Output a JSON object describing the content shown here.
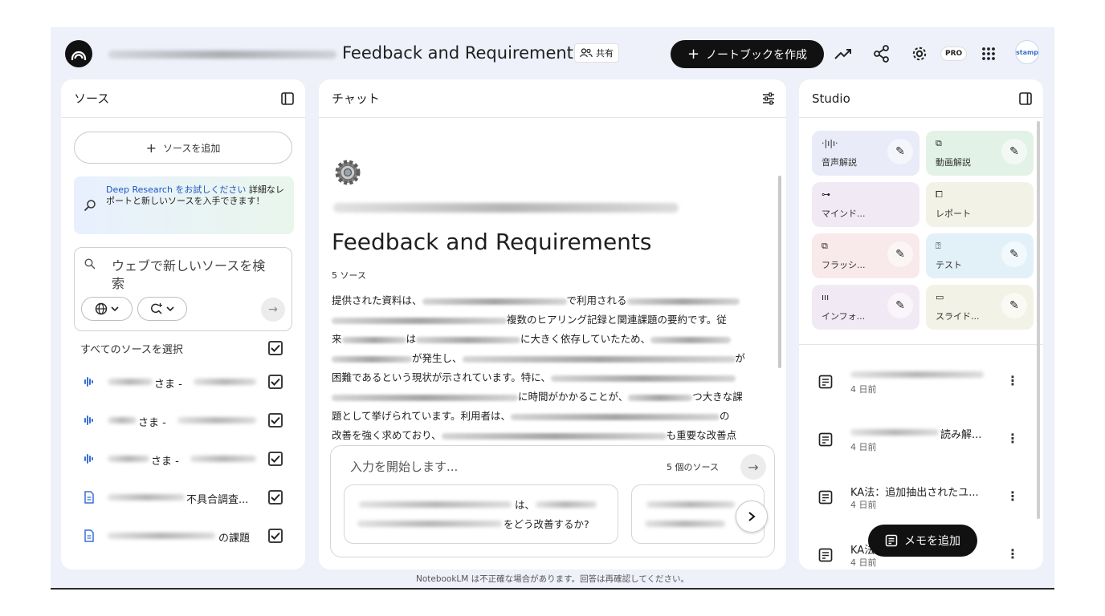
{
  "header": {
    "title": "Feedback and Requirements",
    "share_label": "共有",
    "create_button": "ノートブックを作成",
    "pro_badge": "PRO",
    "avatar_text": "stamp"
  },
  "sources_panel": {
    "title": "ソース",
    "add_button": "ソースを追加",
    "deep_research": {
      "link_text": "Deep Research をお試しください",
      "text": " 詳細なレポートと新しいソースを入手できます！"
    },
    "search_placeholder": "ウェブで新しいソースを検索",
    "select_all_label": "すべてのソースを選択",
    "items": [
      {
        "type": "audio",
        "label": "さま - ",
        "checked": true
      },
      {
        "type": "audio",
        "label": "さま - ",
        "checked": true
      },
      {
        "type": "audio",
        "label": "さま - ",
        "checked": true
      },
      {
        "type": "doc",
        "label": "不具合調査...",
        "checked": true
      },
      {
        "type": "doc",
        "label": "の課題",
        "checked": true
      }
    ]
  },
  "chat_panel": {
    "title": "チャット",
    "notebook_title": "Feedback and Requirements",
    "source_count": "5 ソース",
    "summary": {
      "l1a": "提供された資料は、",
      "l1b": "で利用される",
      "l2": "複数のヒアリング記録と関連課題の要約です。従",
      "l3a": "来",
      "l3b": "は",
      "l3c": "に大きく依存していたため、",
      "l4a": "が発生し、",
      "l4b": "が",
      "l5": "困難であるという現状が示されています。特に、",
      "l6a": "に時間がかかることが、",
      "l6b": "つ大きな課",
      "l7a": "題として挙げられています。利用者は、",
      "l7b": "の",
      "l8a": "改善を強く求めており、",
      "l8b": "も重要な改善点"
    },
    "composer_placeholder": "入力を開始します...",
    "composer_source_count": "5 個のソース",
    "suggestions": [
      {
        "line1": "は、",
        "line2": "をどう改善するか?"
      }
    ],
    "footer_note": "NotebookLM は不正確な場合があります。回答は再確認してください。"
  },
  "studio_panel": {
    "title": "Studio",
    "tiles": [
      {
        "label": "音声解説",
        "color": "#e9ebf8"
      },
      {
        "label": "動画解説",
        "color": "#e2f2e6"
      },
      {
        "label": "マインド...",
        "color": "#f1e9f3"
      },
      {
        "label": "レポート",
        "color": "#f3f2e6"
      },
      {
        "label": "フラッシ...",
        "color": "#f8e9ea"
      },
      {
        "label": "テスト",
        "color": "#e2f1f8"
      },
      {
        "label": "インフォ...",
        "color": "#f1e9f3"
      },
      {
        "label": "スライド...",
        "color": "#f3f2e6"
      }
    ],
    "notes": [
      {
        "title": "",
        "time": "4 日前"
      },
      {
        "title": "読み解...",
        "time": "4 日前"
      },
      {
        "title": "KA法：追加抽出されたユ...",
        "time": "4 日前"
      },
      {
        "title": "KA法...",
        "time": "4 日前"
      }
    ],
    "memo_button": "メモを追加"
  }
}
